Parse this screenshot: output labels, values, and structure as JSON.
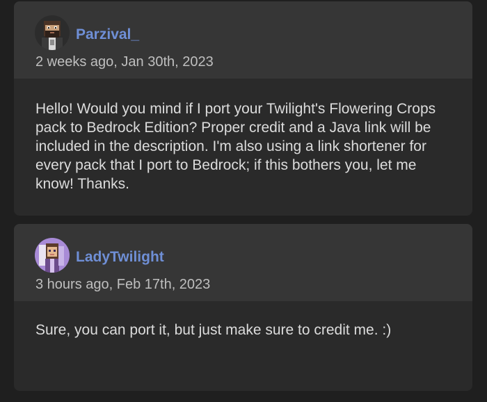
{
  "comments": [
    {
      "username": "Parzival_",
      "timestamp": "2 weeks ago, Jan 30th, 2023",
      "body": "Hello! Would you mind if I port your Twilight's Flowering Crops pack to Bedrock Edition? Proper credit and a Java link will be included in the description. I'm also using a link shortener for every pack that I port to Bedrock; if this bothers you, let me know! Thanks.",
      "avatar_icon": "minecraft-skin-avatar-bearded"
    },
    {
      "username": "LadyTwilight",
      "timestamp": "3 hours ago, Feb 17th, 2023",
      "body": "Sure, you can port it, but just make sure to credit me. :)",
      "avatar_icon": "minecraft-skin-avatar-purple"
    }
  ],
  "colors": {
    "background": "#1f1f1f",
    "card": "#2a2a2a",
    "card_header": "#363636",
    "username": "#6f8fd6",
    "timestamp": "#bfbfbf",
    "body_text": "#dcdcdc"
  }
}
